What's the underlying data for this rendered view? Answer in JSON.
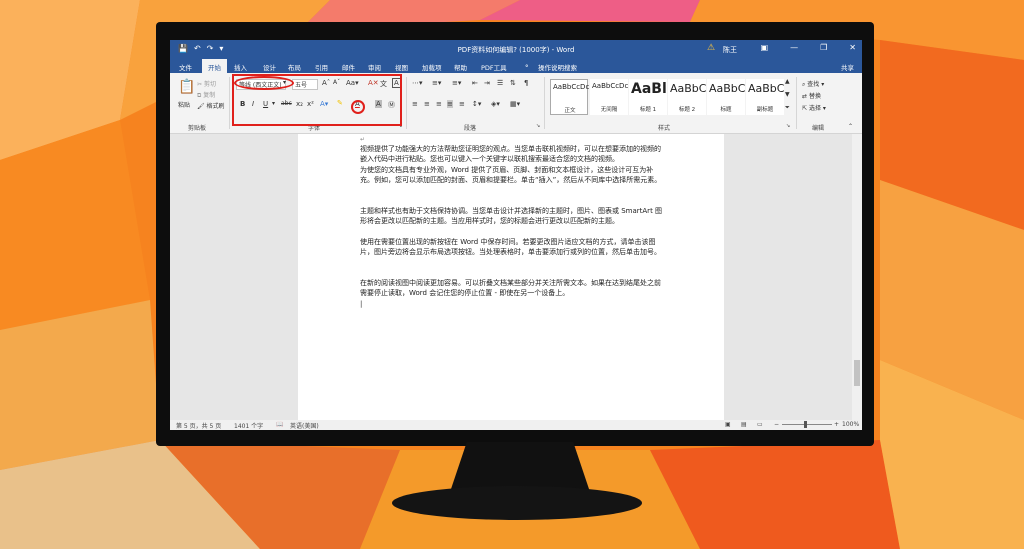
{
  "title_bar": {
    "doc_title": "PDF资料如何编辑?  (1000字)  -  Word",
    "user": "陈王",
    "icons": [
      "save-icon",
      "undo-icon",
      "redo-icon",
      "customize-qat-icon"
    ],
    "window_buttons": [
      "▣",
      "—",
      "❐",
      "✕"
    ]
  },
  "tabs": [
    "文件",
    "开始",
    "插入",
    "设计",
    "布局",
    "引用",
    "邮件",
    "审阅",
    "视图",
    "加载项",
    "帮助",
    "PDF工具"
  ],
  "active_tab": "开始",
  "tell_me": "操作说明搜索",
  "share": "共享",
  "clipboard": {
    "paste": "粘贴",
    "cut": "剪切",
    "copy": "复制",
    "format_painter": "格式刷",
    "label": "剪贴板"
  },
  "font": {
    "name": "等线 (西文正文)",
    "size": "五号",
    "label": "字体"
  },
  "paragraph": {
    "label": "段落"
  },
  "styles": {
    "label": "样式",
    "items": [
      {
        "preview": "AaBbCcDc",
        "name": "正文"
      },
      {
        "preview": "AaBbCcDc",
        "name": "无间隔"
      },
      {
        "preview": "AaBl",
        "name": "标题 1"
      },
      {
        "preview": "AaBbC",
        "name": "标题 2"
      },
      {
        "preview": "AaBbC",
        "name": "标题"
      },
      {
        "preview": "AaBbC",
        "name": "副标题"
      }
    ]
  },
  "editing": {
    "find": "查找",
    "replace": "替换",
    "select": "选择",
    "label": "编辑"
  },
  "document": {
    "paragraphs": [
      "视频提供了功能强大的方法帮助您证明您的观点。当您单击联机视频时，可以在想要添加的视频的嵌入代码中进行粘贴。您也可以键入一个关键字以联机搜索最适合您的文档的视频。",
      "为使您的文档具有专业外观，Word 提供了页眉、页脚、封面和文本框设计，这些设计可互为补充。例如，您可以添加匹配的封面、页眉和提要栏。单击“插入”，然后从不同库中选择所需元素。",
      "主题和样式也有助于文档保持协调。当您单击设计并选择新的主题时，图片、图表或 SmartArt 图形将会更改以匹配新的主题。当应用样式时，您的标题会进行更改以匹配新的主题。",
      "使用在需要位置出现的新按钮在 Word 中保存时间。若要更改图片适应文档的方式，请单击该图片，图片旁边将会显示布局选项按钮。当处理表格时，单击要添加行或列的位置，然后单击加号。",
      "在新的阅读视图中阅读更加容易。可以折叠文档某些部分并关注所需文本。如果在达到结尾处之前需要停止读取，Word 会记住您的停止位置 - 即使在另一个设备上。"
    ]
  },
  "status_bar": {
    "page": "第 5 页，共 5 页",
    "words": "1401 个字",
    "language": "英语(美国)",
    "zoom": "100%"
  }
}
